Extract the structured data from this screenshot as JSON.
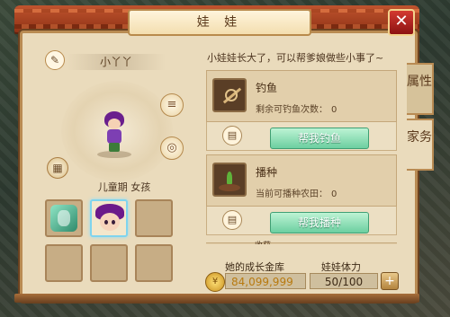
{
  "window": {
    "title": "娃 娃",
    "close_glyph": "✕"
  },
  "child": {
    "name": "小丫丫",
    "stage_text": "儿童期 女孩"
  },
  "side_tabs": [
    {
      "label": "属性",
      "active": false
    },
    {
      "label": "家务",
      "active": true
    }
  ],
  "hint": "小娃娃长大了，可以帮爹娘做些小事了~",
  "tasks": [
    {
      "name": "钓鱼",
      "desc_label": "剩余可钓鱼次数：",
      "desc_value": "0",
      "button": "帮我钓鱼",
      "icon": "fishing-rod-icon"
    },
    {
      "name": "播种",
      "desc_label": "当前可播种农田：",
      "desc_value": "0",
      "button": "帮我播种",
      "icon": "sprout-icon"
    },
    {
      "name": "收获",
      "icon": "harvest-icon"
    }
  ],
  "stats": {
    "gold_label": "她的成长金库",
    "gold_value": "84,099,999",
    "stamina_label": "娃娃体力",
    "stamina_value": "50/100",
    "plus_glyph": "+"
  },
  "colors": {
    "accent_green": "#6ccfa0",
    "frame": "#b98b53",
    "close_red": "#c0282a"
  }
}
